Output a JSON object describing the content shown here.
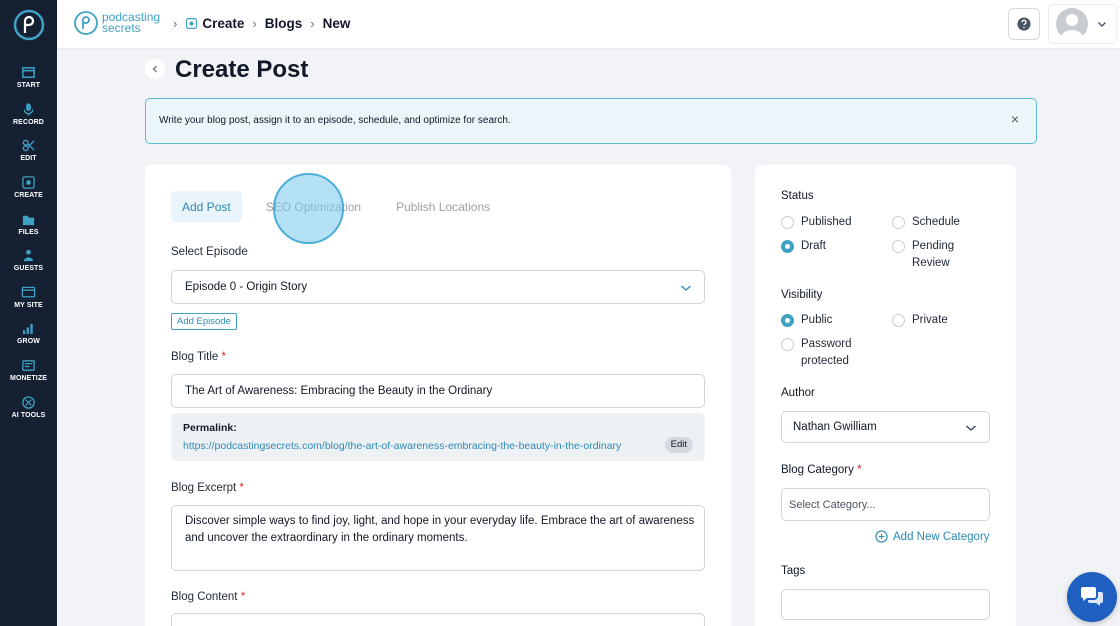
{
  "sidebar": {
    "items": [
      {
        "label": "START",
        "icon": "start-icon"
      },
      {
        "label": "RECORD",
        "icon": "microphone-icon"
      },
      {
        "label": "EDIT",
        "icon": "edit-icon"
      },
      {
        "label": "CREATE",
        "icon": "create-icon"
      },
      {
        "label": "FILES",
        "icon": "files-icon"
      },
      {
        "label": "GUESTS",
        "icon": "guests-icon"
      },
      {
        "label": "MY SITE",
        "icon": "my-site-icon"
      },
      {
        "label": "GROW",
        "icon": "grow-icon"
      },
      {
        "label": "MONETIZE",
        "icon": "monetize-icon"
      },
      {
        "label": "AI TOOLS",
        "icon": "ai-tools-icon"
      }
    ]
  },
  "header": {
    "brand_line1": "podcasting",
    "brand_line2": "secrets",
    "breadcrumb": {
      "create": "Create",
      "blogs": "Blogs",
      "new": "New"
    }
  },
  "page": {
    "title": "Create Post",
    "banner_text": "Write your blog post, assign it to an episode, schedule, and optimize for search.",
    "banner_close": "×"
  },
  "tabs": [
    "Add Post",
    "SEO Optimization",
    "Publish Locations"
  ],
  "form": {
    "select_episode_label": "Select Episode",
    "episode_value": "Episode 0 - Origin Story",
    "add_episode": "Add Episode",
    "blog_title_label": "Blog Title",
    "blog_title_value": "The Art of Awareness: Embracing the Beauty in the Ordinary",
    "permalink_label": "Permalink:",
    "permalink_url": "https://podcastingsecrets.com/blog/the-art-of-awareness-embracing-the-beauty-in-the-ordinary",
    "edit": "Edit",
    "excerpt_label": "Blog Excerpt",
    "excerpt_value": "Discover simple ways to find joy, light, and hope in your everyday life. Embrace the art of awareness and uncover the extraordinary in the ordinary moments.",
    "content_label": "Blog Content",
    "required_mark": "*"
  },
  "side": {
    "status_label": "Status",
    "status_options": [
      "Published",
      "Schedule",
      "Draft",
      "Pending Review"
    ],
    "visibility_label": "Visibility",
    "visibility_options": [
      "Public",
      "Private",
      "Password protected"
    ],
    "author_label": "Author",
    "author_value": "Nathan Gwilliam",
    "category_label": "Blog Category",
    "category_placeholder": "Select Category...",
    "add_category": "Add New Category",
    "tags_label": "Tags"
  },
  "colors": {
    "accent": "#3fa1c4",
    "sidebar": "#162033",
    "chat": "#1f5fbf"
  }
}
